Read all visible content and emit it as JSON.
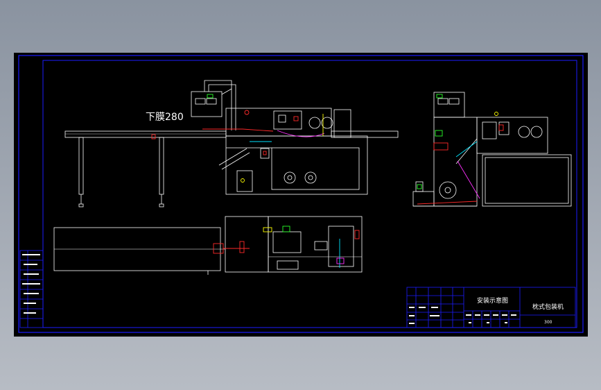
{
  "drawing": {
    "main_label": "下膜280",
    "title_block": {
      "drawing_title": "安装示意图",
      "machine_name": "枕式包装机",
      "model_code": "300"
    }
  },
  "colors": {
    "background": "#000000",
    "frame": "#1c1cff",
    "lines": "#ffffff",
    "accent_red": "#ff2a2a",
    "accent_green": "#2aff2a",
    "accent_cyan": "#00e5ff",
    "accent_yellow": "#ffff00",
    "accent_magenta": "#ff30ff"
  }
}
